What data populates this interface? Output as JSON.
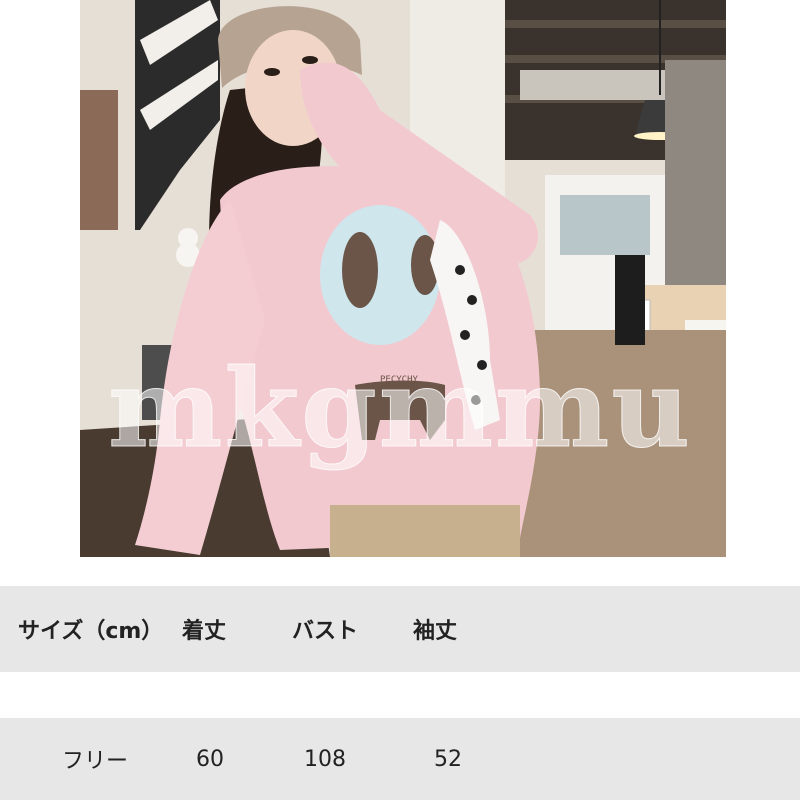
{
  "photo": {
    "sweater_text": "PECYCHY"
  },
  "watermark": "mkgmmu",
  "size_table": {
    "headers": [
      "サイズ（cm）",
      "着丈",
      "バスト",
      "袖丈"
    ],
    "rows": [
      [
        "フリー",
        "60",
        "108",
        "52"
      ]
    ]
  },
  "colors": {
    "table_bg": "#e7e7e7",
    "sweater": "#f2c9cf",
    "text": "#222222"
  }
}
